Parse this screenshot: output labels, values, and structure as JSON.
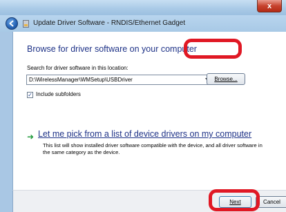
{
  "window": {
    "title": "Update Driver Software - RNDIS/Ethernet Gadget",
    "close_label": "x"
  },
  "page": {
    "heading": "Browse for driver software on your computer",
    "location_label": "Search for driver software in this location:",
    "location_value": "D:\\WirelessManager\\WMSetup\\USBDriver",
    "browse_label": "Browse...",
    "include_subfolders_label": "Include subfolders",
    "include_subfolders_checked": true,
    "pick_link": "Let me pick from a list of device drivers on my computer",
    "pick_description": "This list will show installed driver software compatible with the device, and all driver software in the same category as the device."
  },
  "footer": {
    "next_label": "Next",
    "cancel_label": "Cancel"
  },
  "highlights": {
    "ring_color": "#e01824"
  },
  "icons": {
    "back": "back-arrow-icon",
    "device": "device-icon",
    "link_arrow": "green-arrow-icon"
  }
}
